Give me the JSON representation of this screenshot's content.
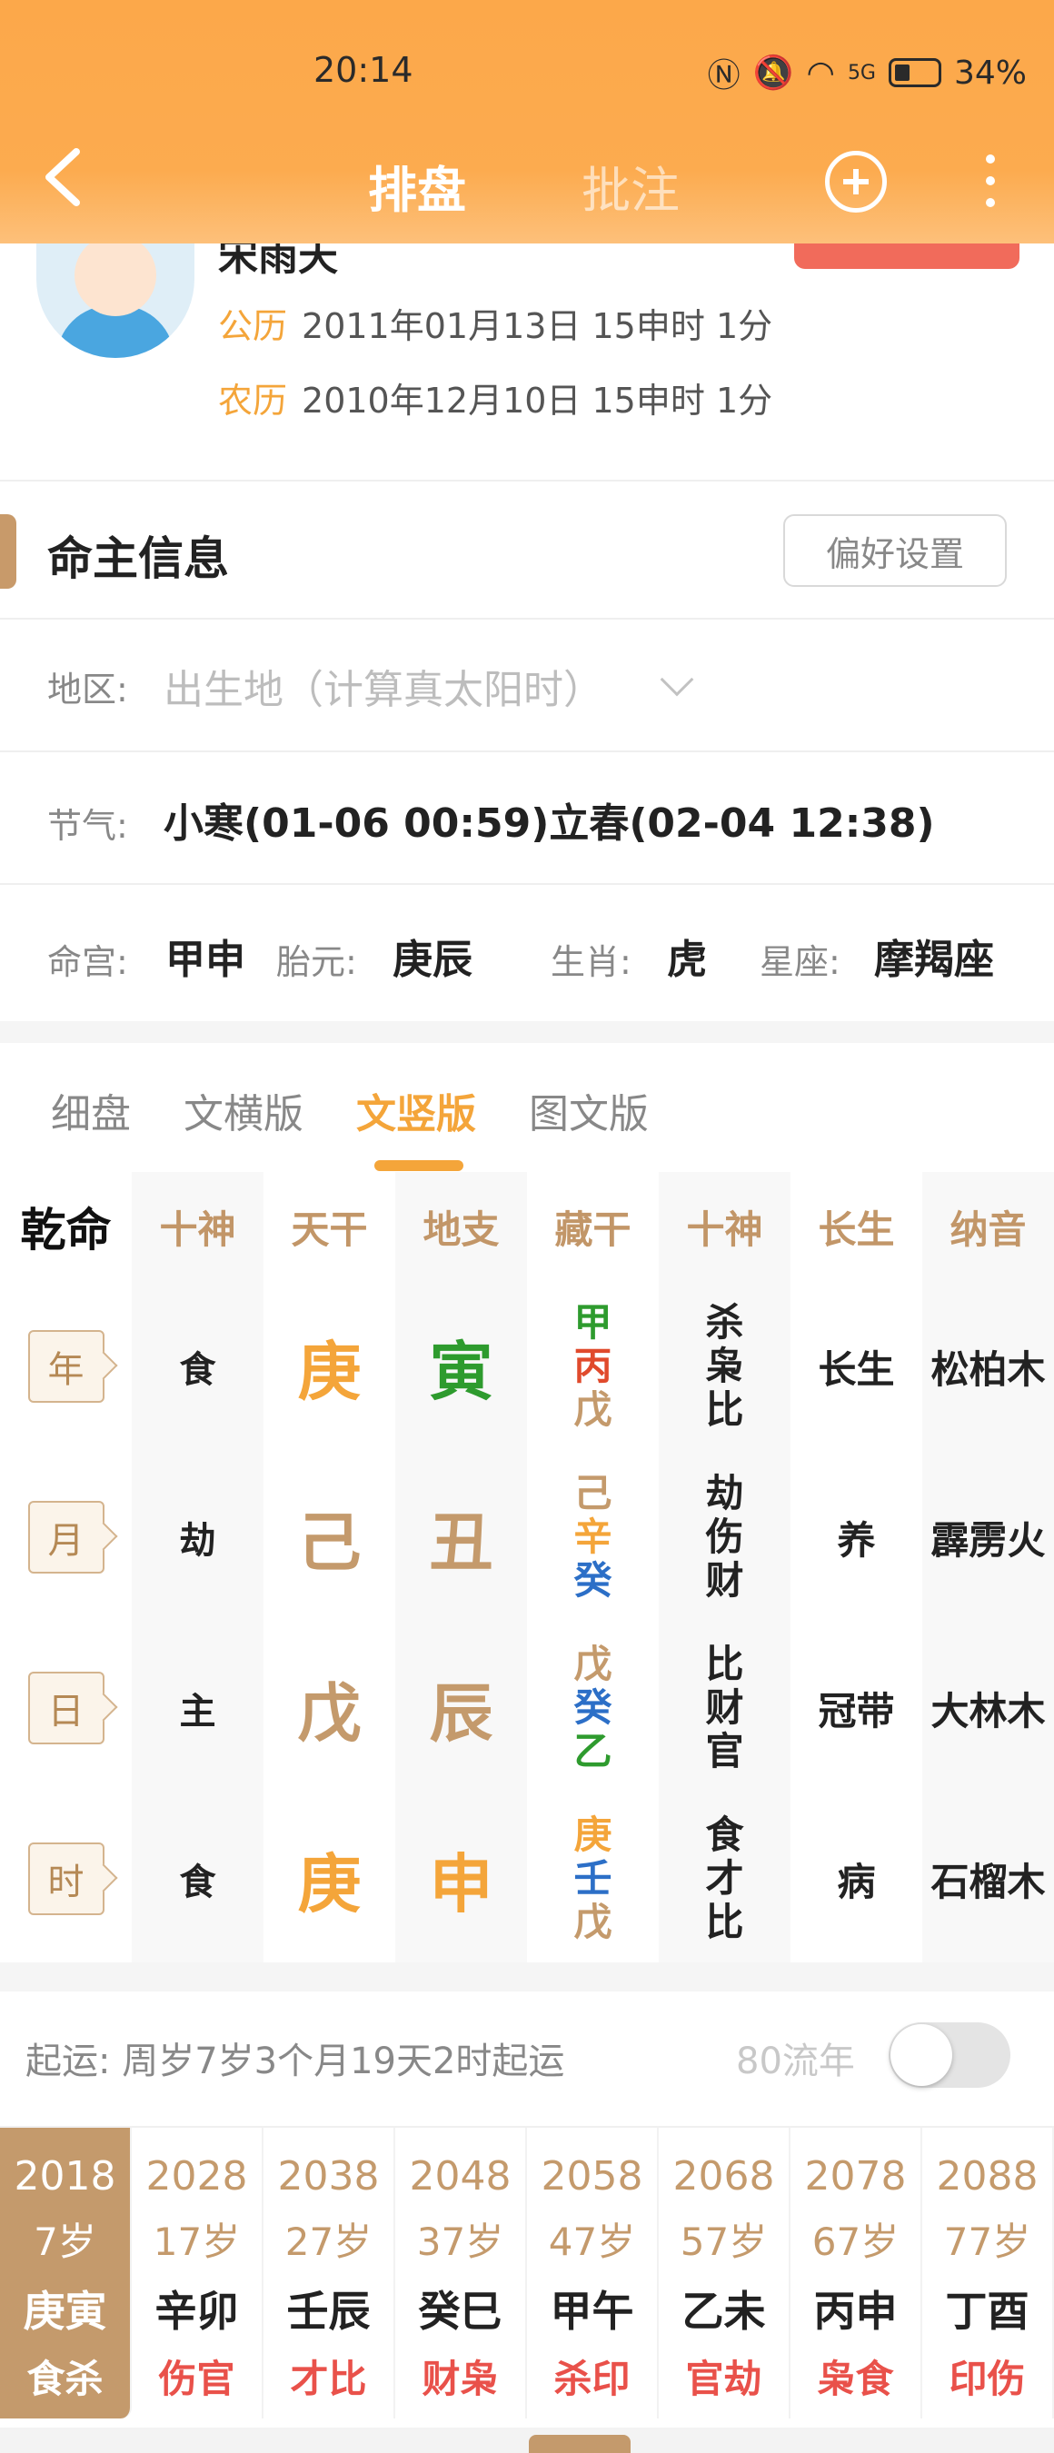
{
  "status_bar": {
    "time": "20:14",
    "battery": "34%",
    "signal": "5G"
  },
  "nav": {
    "tab_active": "排盘",
    "tab_other": "批注"
  },
  "profile": {
    "name_partial": "宋雨天",
    "solar_label": "公历",
    "solar_value": "2011年01月13日 15申时 1分",
    "lunar_label": "农历",
    "lunar_value": "2010年12月10日 15申时 1分"
  },
  "info": {
    "title": "命主信息",
    "pref_button": "偏好设置",
    "region_label": "地区:",
    "region_placeholder": "出生地（计算真太阳时）",
    "jieqi_label": "节气:",
    "jieqi_value": "小寒(01-06 00:59)立春(02-04 12:38)",
    "minggong_label": "命宫:",
    "minggong_value": "甲申",
    "taiyuan_label": "胎元:",
    "taiyuan_value": "庚辰",
    "shengxiao_label": "生肖:",
    "shengxiao_value": "虎",
    "xingzuo_label": "星座:",
    "xingzuo_value": "摩羯座"
  },
  "view_tabs": [
    "细盘",
    "文横版",
    "文竖版",
    "图文版"
  ],
  "chart_headers": [
    "乾命",
    "十神",
    "天干",
    "地支",
    "藏干",
    "十神",
    "长生",
    "纳音"
  ],
  "pillars": [
    {
      "label": "年",
      "shishen": "食",
      "gan": "庚",
      "gan_color": "#f4a53a",
      "zhi": "寅",
      "zhi_color": "#2e9b2e",
      "canggan": [
        {
          "c": "甲",
          "color": "#2e9b2e"
        },
        {
          "c": "丙",
          "color": "#e04a2c"
        },
        {
          "c": "戊",
          "color": "#c49a6c"
        }
      ],
      "shishen2": [
        "杀",
        "枭",
        "比"
      ],
      "changsheng": "长生",
      "nayin": "松柏木"
    },
    {
      "label": "月",
      "shishen": "劫",
      "gan": "己",
      "gan_color": "#c49a6c",
      "zhi": "丑",
      "zhi_color": "#c49a6c",
      "canggan": [
        {
          "c": "己",
          "color": "#c49a6c"
        },
        {
          "c": "辛",
          "color": "#f4a53a"
        },
        {
          "c": "癸",
          "color": "#2c6fc7"
        }
      ],
      "shishen2": [
        "劫",
        "伤",
        "财"
      ],
      "changsheng": "养",
      "nayin": "霹雳火"
    },
    {
      "label": "日",
      "shishen": "主",
      "gan": "戊",
      "gan_color": "#c49a6c",
      "zhi": "辰",
      "zhi_color": "#c49a6c",
      "canggan": [
        {
          "c": "戊",
          "color": "#c49a6c"
        },
        {
          "c": "癸",
          "color": "#2c6fc7"
        },
        {
          "c": "乙",
          "color": "#2e9b2e"
        }
      ],
      "shishen2": [
        "比",
        "财",
        "官"
      ],
      "changsheng": "冠带",
      "nayin": "大林木"
    },
    {
      "label": "时",
      "shishen": "食",
      "gan": "庚",
      "gan_color": "#f4a53a",
      "zhi": "申",
      "zhi_color": "#f4a53a",
      "canggan": [
        {
          "c": "庚",
          "color": "#f4a53a"
        },
        {
          "c": "壬",
          "color": "#2c6fc7"
        },
        {
          "c": "戊",
          "color": "#c49a6c"
        }
      ],
      "shishen2": [
        "食",
        "才",
        "比"
      ],
      "changsheng": "病",
      "nayin": "石榴木"
    }
  ],
  "qiyun": {
    "text": "起运:  周岁7岁3个月19天2时起运",
    "liunian_label": "80流年"
  },
  "dayun": [
    {
      "year": "2018",
      "age": "7岁",
      "ganzhi": "庚寅",
      "shishen": "食杀"
    },
    {
      "year": "2028",
      "age": "17岁",
      "ganzhi": "辛卯",
      "shishen": "伤官"
    },
    {
      "year": "2038",
      "age": "27岁",
      "ganzhi": "壬辰",
      "shishen": "才比"
    },
    {
      "year": "2048",
      "age": "37岁",
      "ganzhi": "癸巳",
      "shishen": "财枭"
    },
    {
      "year": "2058",
      "age": "47岁",
      "ganzhi": "甲午",
      "shishen": "杀印"
    },
    {
      "year": "2068",
      "age": "57岁",
      "ganzhi": "乙未",
      "shishen": "官劫"
    },
    {
      "year": "2078",
      "age": "67岁",
      "ganzhi": "丙申",
      "shishen": "枭食"
    },
    {
      "year": "2088",
      "age": "77岁",
      "ganzhi": "丁酉",
      "shishen": "印伤"
    }
  ]
}
